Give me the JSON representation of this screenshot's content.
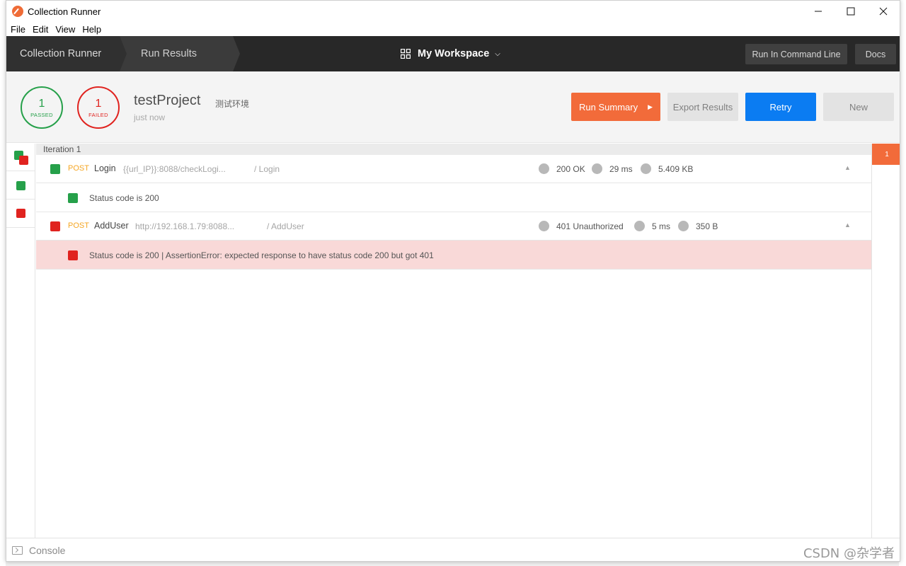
{
  "window": {
    "title": "Collection Runner"
  },
  "menu": [
    "File",
    "Edit",
    "View",
    "Help"
  ],
  "nav": {
    "crumbs": [
      "Collection Runner",
      "Run Results"
    ],
    "workspace": "My Workspace",
    "run_cli": "Run In Command Line",
    "docs": "Docs"
  },
  "summary": {
    "passed_count": "1",
    "passed_label": "PASSED",
    "failed_count": "1",
    "failed_label": "FAILED",
    "project": "testProject",
    "environment": "测试环境",
    "time": "just now"
  },
  "actions": {
    "run_summary": "Run Summary",
    "export": "Export Results",
    "retry": "Retry",
    "new": "New"
  },
  "iteration": {
    "label": "Iteration 1",
    "badge": "1"
  },
  "requests": [
    {
      "status": "pass",
      "method": "POST",
      "name": "Login",
      "url": "{{url_IP}}:8088/checkLogi...",
      "path": "/ Login",
      "code": "200 OK",
      "time": "29 ms",
      "size": "5.409 KB",
      "test": {
        "status": "pass",
        "text": "Status code is 200"
      }
    },
    {
      "status": "fail",
      "method": "POST",
      "name": "AddUser",
      "url": "http://192.168.1.79:8088...",
      "path": "/ AddUser",
      "code": "401 Unauthorized",
      "time": "5 ms",
      "size": "350 B",
      "test": {
        "status": "fail",
        "text": "Status code is 200 | AssertionError: expected response to have status code 200 but got 401"
      }
    }
  ],
  "footer": {
    "console": "Console"
  },
  "watermark": "CSDN @杂学者",
  "colors": {
    "pass": "#26a04a",
    "fail": "#e0231f",
    "accent": "#f26b3a",
    "primary": "#0b7cf2"
  },
  "icons": {
    "app": "postman-icon",
    "workspace": "grid-icon",
    "console": "terminal-icon"
  }
}
